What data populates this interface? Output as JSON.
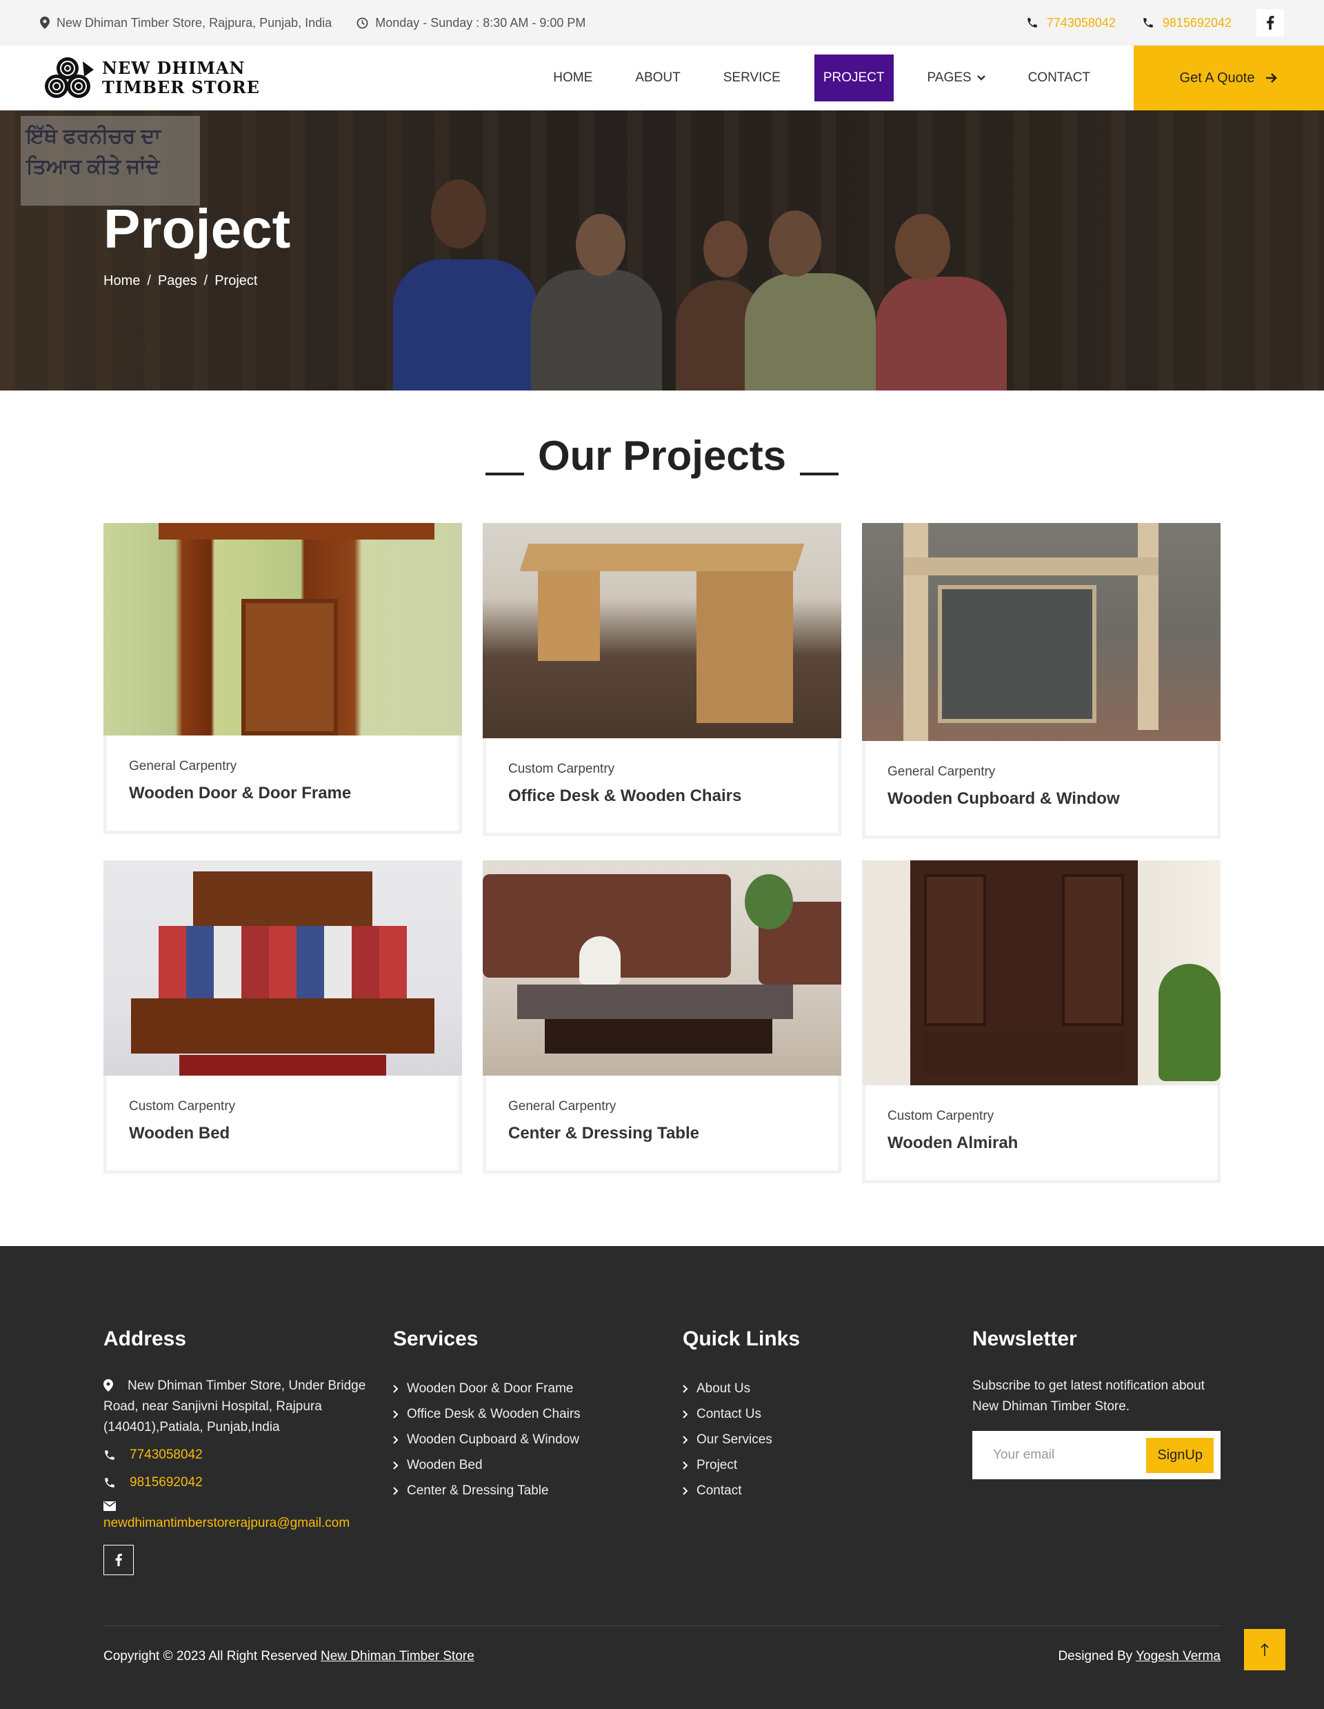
{
  "topbar": {
    "address": "New Dhiman Timber Store, Rajpura, Punjab, India",
    "hours": "Monday - Sunday : 8:30 AM - 9:00 PM",
    "phone1": "7743058042",
    "phone2": "9815692042"
  },
  "header": {
    "logo_line1": "NEW DHIMAN",
    "logo_line2": "TIMBER STORE",
    "nav": {
      "home": "HOME",
      "about": "ABOUT",
      "service": "SERVICE",
      "project": "PROJECT",
      "pages": "PAGES",
      "contact": "CONTACT"
    },
    "quote_label": "Get A Quote"
  },
  "hero": {
    "title": "Project",
    "hero_sign_text": "ਇੱਥੇ ਫਰਨੀਚਰ ਦਾ ਤਿਆਰ ਕੀਤੇ ਜਾਂਦੇ",
    "breadcrumb": [
      "Home",
      "Pages",
      "Project"
    ]
  },
  "projects": {
    "heading": "Our Projects",
    "items": [
      {
        "category": "General Carpentry",
        "title": "Wooden Door & Door Frame"
      },
      {
        "category": "Custom Carpentry",
        "title": "Office Desk & Wooden Chairs"
      },
      {
        "category": "General Carpentry",
        "title": "Wooden Cupboard & Window"
      },
      {
        "category": "Custom Carpentry",
        "title": "Wooden Bed"
      },
      {
        "category": "General Carpentry",
        "title": "Center & Dressing Table"
      },
      {
        "category": "Custom Carpentry",
        "title": "Wooden Almirah"
      }
    ]
  },
  "footer": {
    "address_heading": "Address",
    "address_text": "New Dhiman Timber Store, Under Bridge Road, near Sanjivni Hospital, Rajpura (140401),Patiala, Punjab,India",
    "phone1": "7743058042",
    "phone2": "9815692042",
    "email": "newdhimantimberstorerajpura@gmail.com",
    "services_heading": "Services",
    "services": [
      "Wooden Door & Door Frame",
      "Office Desk & Wooden Chairs",
      "Wooden Cupboard & Window",
      "Wooden Bed",
      "Center & Dressing Table"
    ],
    "quicklinks_heading": "Quick Links",
    "quicklinks": [
      "About Us",
      "Contact Us",
      "Our Services",
      "Project",
      "Contact"
    ],
    "newsletter_heading": "Newsletter",
    "newsletter_text": "Subscribe to get latest notification about New Dhiman Timber Store.",
    "email_placeholder": "Your email",
    "signup_label": "SignUp",
    "copyright_prefix": "Copyright © 2023 All Right Reserved",
    "copyright_link": "New Dhiman Timber Store",
    "designed_prefix": "Designed By",
    "designed_link": "Yogesh Verma"
  },
  "colors": {
    "accent": "#f8bb0a",
    "nav_active": "#4a0f8c",
    "footer_bg": "#2b2b2b"
  }
}
